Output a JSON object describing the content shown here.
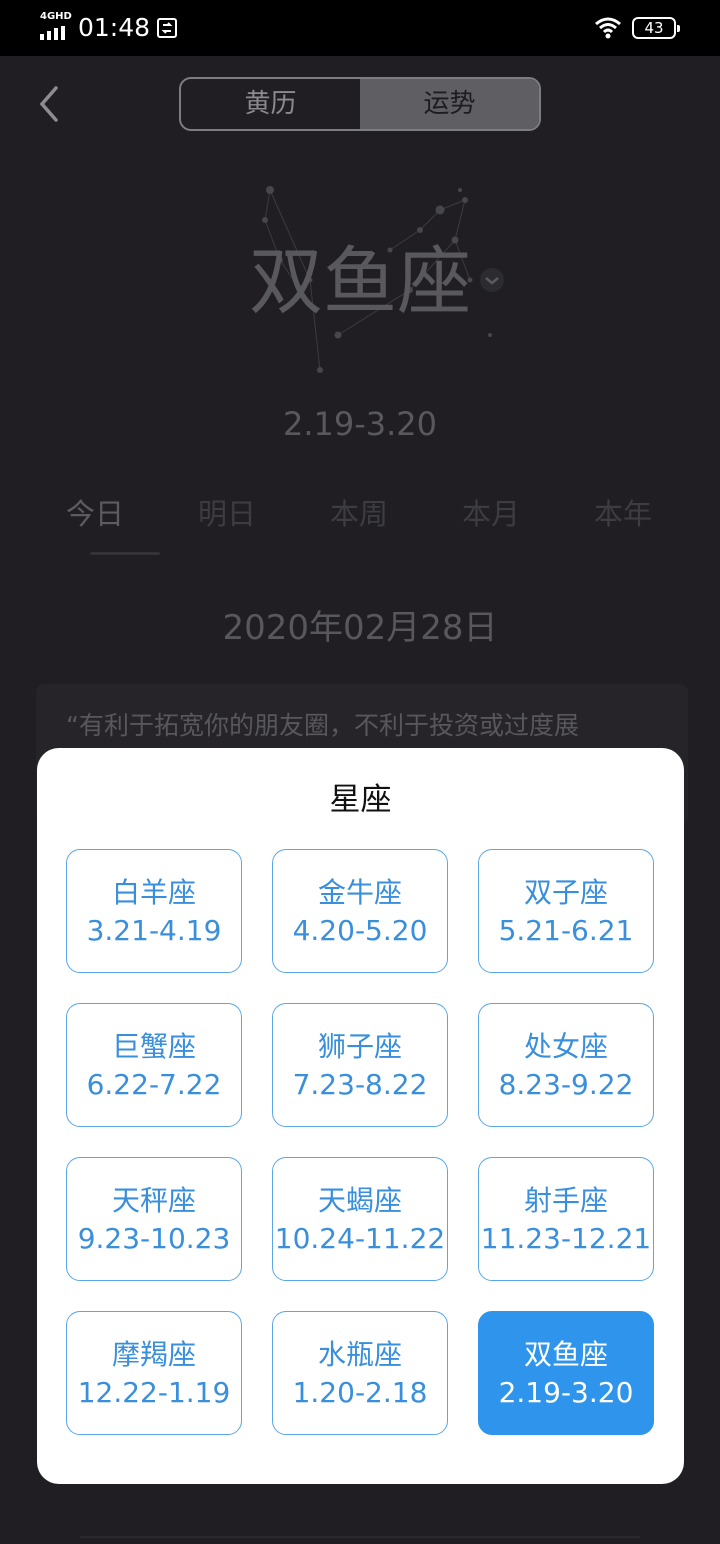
{
  "status_bar": {
    "network": "4GHD",
    "time": "01:48",
    "battery": "43"
  },
  "header": {
    "tabs": [
      {
        "label": "黄历"
      },
      {
        "label": "运势"
      }
    ]
  },
  "sign": {
    "name": "双鱼座",
    "range": "2.19-3.20"
  },
  "period_tabs": [
    {
      "label": "今日"
    },
    {
      "label": "明日"
    },
    {
      "label": "本周"
    },
    {
      "label": "本月"
    },
    {
      "label": "本年"
    }
  ],
  "date": "2020年02月28日",
  "quote": "“有利于拓宽你的朋友圈，不利于投资或过度展",
  "picker": {
    "title": "星座",
    "signs": [
      {
        "name": "白羊座",
        "range": "3.21-4.19"
      },
      {
        "name": "金牛座",
        "range": "4.20-5.20"
      },
      {
        "name": "双子座",
        "range": "5.21-6.21"
      },
      {
        "name": "巨蟹座",
        "range": "6.22-7.22"
      },
      {
        "name": "狮子座",
        "range": "7.23-8.22"
      },
      {
        "name": "处女座",
        "range": "8.23-9.22"
      },
      {
        "name": "天秤座",
        "range": "9.23-10.23"
      },
      {
        "name": "天蝎座",
        "range": "10.24-11.22"
      },
      {
        "name": "射手座",
        "range": "11.23-12.21"
      },
      {
        "name": "摩羯座",
        "range": "12.22-1.19"
      },
      {
        "name": "水瓶座",
        "range": "1.20-2.18"
      },
      {
        "name": "双鱼座",
        "range": "2.19-3.20"
      }
    ],
    "selected": "双鱼座"
  },
  "colors": {
    "accent": "#2f95ec",
    "card_border": "#5aa6e6",
    "card_text": "#3a8fdc",
    "background": "#201e22"
  }
}
